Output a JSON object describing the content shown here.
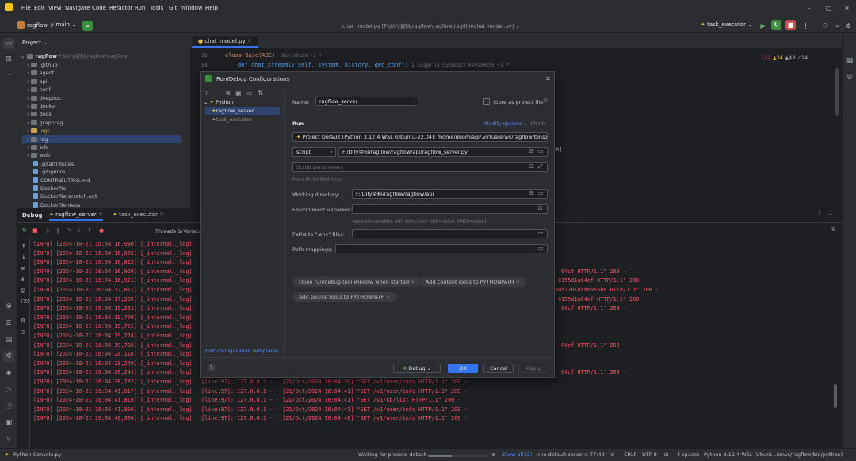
{
  "titlebar": {
    "project_name": "ragflow",
    "branch": "main",
    "menu": [
      "File",
      "Edit",
      "View",
      "Navigate",
      "Code",
      "Refactor",
      "Run",
      "Tools",
      "Git",
      "Window",
      "Help"
    ],
    "file_title": "chat_model.py [F:\\Dify资料\\ragflow\\ragflow\\rag\\llm\\chat_model.py]",
    "run_config": "task_executor"
  },
  "project": {
    "header": "Project",
    "root_label": "ragflow",
    "root_path": "F:\\Dify资料\\ragflow\\ragflow",
    "items": [
      ".github",
      "agent",
      "api",
      "conf",
      "deepdoc",
      "docker",
      "docs",
      "graphrag",
      "logs",
      "rag",
      "sdk",
      "web",
      ".gitattributes",
      ".gitignore",
      "CONTRIBUTING.md",
      "Dockerfile",
      "Dockerfile.scratch.oc9",
      "Dockerfile.deps"
    ]
  },
  "editor": {
    "tab": "chat_model.py",
    "line1_no": "32",
    "line1_code": "class Base(ABC):",
    "line1_hint": "KevinHuSh +2 *",
    "line2_no": "54",
    "line2_code": "def chat_streamly(self, system, history, gen_conf):",
    "line2_hint": "1 usage (1 dynamic)  KevinHuSh +1 *",
    "inspections": [
      "2",
      "34",
      "43",
      "14"
    ],
    "partial_code": "sh("
  },
  "debug": {
    "title": "Debug",
    "tabs": [
      "ragflow_server",
      "task_executor"
    ],
    "sub": "Threads & Variabl",
    "logs_left": [
      "[INFO] [2024-10-21 16:04:16,930] [_internal._log]",
      "[INFO] [2024-10-21 16:04:16,805] [_internal._log]",
      "[INFO] [2024-10-21 16:04:16,815] [_internal._log]",
      "[INFO] [2024-10-21 16:04:16,920] [_internal._log]",
      "[INFO] [2024-10-21 16:04:16,921] [_internal._log]",
      "[INFO] [2024-10-21 16:04:17,011] [_internal._log]",
      "[INFO] [2024-10-21 16:04:17,205] [_internal._log]",
      "[INFO] [2024-10-21 16:04:19,231] [_internal._log]",
      "[INFO] [2024-10-21 16:04:19,709] [_internal._log]",
      "[INFO] [2024-10-21 16:04:19,721] [_internal._log]",
      "[INFO] [2024-10-21 16:04:19,724] [_internal._log]",
      "[INFO] [2024-10-21 16:04:19,736] [_internal._log]",
      "[INFO] [2024-10-21 16:04:28,116] [_internal._log]",
      "[INFO] [2024-10-21 16:04:28,240] [_internal._log]",
      "[INFO] [2024-10-21 16:04:28,241] [_internal._log]",
      "[INFO] [2024-10-21 16:04:36,732] [_internal._log]",
      "[INFO] [2024-10-21 16:04:41,817] [_internal._log]",
      "[INFO] [2024-10-21 16:04:41,818] [_internal._log]",
      "[INFO] [2024-10-21 16:04:41,900] [_internal._log]",
      "[INFO] [2024-10-21 16:04:48,306] [_internal._log]"
    ],
    "logs_right": [
      "64cf HTTP/1.1\" 200 -",
      "0155d1a64cf HTTP/1.1\" 200 -",
      "a0f77018cd6955be HTTP/1.1\" 200 -",
      "0155d1a64cf HTTP/1.1\" 200 -",
      "64cf HTTP/1.1\" 200 -",
      "64cf HTTP/1.1\" 200 -",
      "64cf HTTP/1.1\" 200 -"
    ],
    "logs_full": [
      "[line:97]: 127.0.0.1 - - [21/Oct/2024 16:04:36] \"GET /v1/user/info HTTP/1.1\" 200 -",
      "[line:97]: 127.0.0.1 - - [21/Oct/2024 16:04:41] \"GET /v1/user/info HTTP/1.1\" 200 -",
      "[line:97]: 127.0.0.1 - - [21/Oct/2024 16:04:41] \"GET /v1/kb/list HTTP/1.1\" 200 -",
      "[line:97]: 127.0.0.1 - - [21/Oct/2024 16:04:41] \"GET /v1/user/info HTTP/1.1\" 200 -",
      "[line:97]: 127.0.0.1 - - [21/Oct/2024 16:04:48] \"GET /v1/user/info HTTP/1.1\" 200 -"
    ]
  },
  "dialog": {
    "title": "Run/Debug Configurations",
    "tree_group": "Python",
    "tree_items": [
      "ragflow_server",
      "task_executor"
    ],
    "edit_templates": "Edit configuration templates...",
    "name_label": "Name:",
    "name_value": "ragflow_server",
    "store_label": "Store as project file",
    "run_section": "Run",
    "modify_options": "Modify options",
    "modify_shortcut": "Alt+M",
    "interpreter": "Project Default (Python 3.12.4 WSL (Ubuntu-22.04): /home/duomiagi/.virtualenvs/ragflow/bin/py",
    "script_type": "script",
    "script_path": "F:/Dify资料/ragflow/ragflow/api/ragflow_server.py",
    "script_params_placeholder": "Script parameters",
    "alt_hint": "Press Alt for field hints",
    "workdir_label": "Working directory:",
    "workdir_value": "F:/Dify资料/ragflow/ragflow/api",
    "env_label": "Environment variables:",
    "env_hint": "Separate variables with semicolon: VAR=value; VAR1=value1",
    "envfile_label": "Paths to \".env\" files:",
    "pathmap_label": "Path mappings:",
    "chips": [
      "Open run/debug tool window when started",
      "Add content roots to PYTHONPATH",
      "Add source roots to PYTHONPATH"
    ],
    "btn_debug": "Debug",
    "btn_ok": "OK",
    "btn_cancel": "Cancel",
    "btn_apply": "Apply"
  },
  "statusbar": {
    "left": "Python Console.py",
    "process": "Waiting for process detach",
    "show_all": "Show all (2)",
    "server": "<no default server>",
    "position": "77:49",
    "line_sep": "CRLF",
    "encoding": "UTF-8",
    "indent": "4 spaces",
    "interpreter": "Python 3.12.4 WSL (Ubunt...lenvs/ragflow/bin/python)"
  },
  "colors": {
    "accent": "#3574f0",
    "error": "#f75464",
    "bg": "#1e1f22",
    "panel": "#2b2d30"
  }
}
